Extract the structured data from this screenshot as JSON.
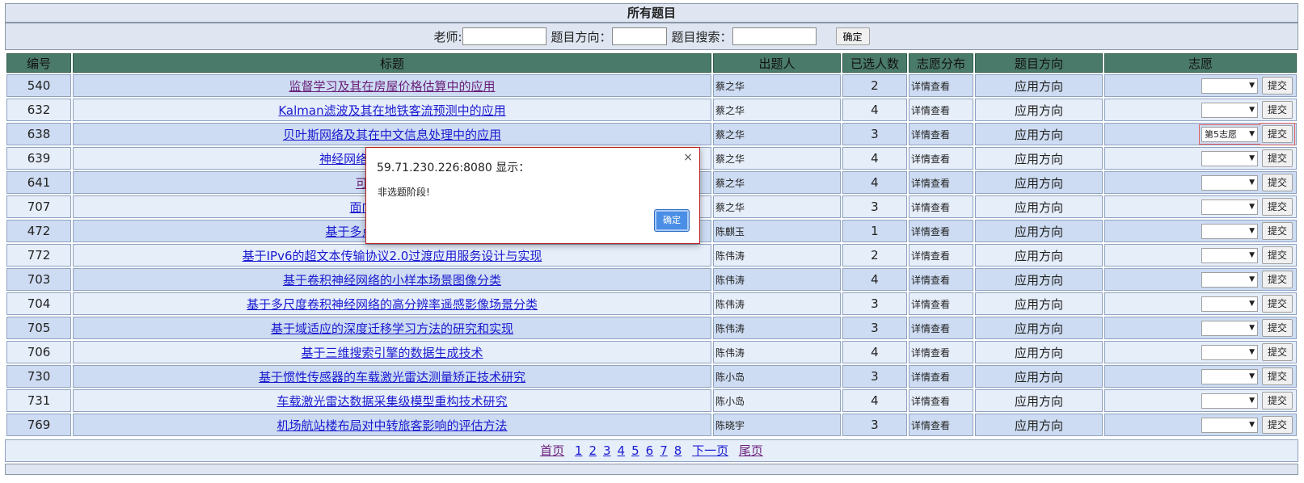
{
  "page_title": "所有题目",
  "search": {
    "teacher_label": "老师:",
    "direction_label": "题目方向：",
    "keyword_label": "题目搜索：",
    "teacher_value": "",
    "direction_value": "",
    "keyword_value": "",
    "confirm_label": "确定"
  },
  "table": {
    "headers": [
      "编号",
      "标题",
      "出题人",
      "已选人数",
      "志愿分布",
      "题目方向",
      "志愿"
    ],
    "submit_label": "提交",
    "rows": [
      {
        "id": "540",
        "title": "监督学习及其在房屋价格估算中的应用",
        "teacher": "蔡之华",
        "count": "2",
        "dist": "详情查看",
        "direction": "应用方向",
        "choice": ""
      },
      {
        "id": "632",
        "title": "Kalman滤波及其在地铁客流预测中的应用",
        "teacher": "蔡之华",
        "count": "4",
        "dist": "详情查看",
        "direction": "应用方向",
        "choice": ""
      },
      {
        "id": "638",
        "title": "贝叶斯网络及其在中文信息处理中的应用",
        "teacher": "蔡之华",
        "count": "3",
        "dist": "详情查看",
        "direction": "应用方向",
        "choice": "第5志愿"
      },
      {
        "id": "639",
        "title": "神经网络预测模型在基于W",
        "teacher": "蔡之华",
        "count": "4",
        "dist": "详情查看",
        "direction": "应用方向",
        "choice": ""
      },
      {
        "id": "641",
        "title": "可持续性指标",
        "teacher": "蔡之华",
        "count": "4",
        "dist": "详情查看",
        "direction": "应用方向",
        "choice": ""
      },
      {
        "id": "707",
        "title": "面向高光谱图像",
        "teacher": "蔡之华",
        "count": "3",
        "dist": "详情查看",
        "direction": "应用方向",
        "choice": ""
      },
      {
        "id": "472",
        "title": "基于多点统计随机模拟的",
        "teacher": "陈麒玉",
        "count": "1",
        "dist": "详情查看",
        "direction": "应用方向",
        "choice": ""
      },
      {
        "id": "772",
        "title": "基于IPv6的超文本传输协议2.0过渡应用服务设计与实现",
        "teacher": "陈伟涛",
        "count": "2",
        "dist": "详情查看",
        "direction": "应用方向",
        "choice": ""
      },
      {
        "id": "703",
        "title": "基于卷积神经网络的小样本场景图像分类",
        "teacher": "陈伟涛",
        "count": "4",
        "dist": "详情查看",
        "direction": "应用方向",
        "choice": ""
      },
      {
        "id": "704",
        "title": "基于多尺度卷积神经网络的高分辨率遥感影像场景分类",
        "teacher": "陈伟涛",
        "count": "3",
        "dist": "详情查看",
        "direction": "应用方向",
        "choice": ""
      },
      {
        "id": "705",
        "title": "基于域适应的深度迁移学习方法的研究和实现",
        "teacher": "陈伟涛",
        "count": "3",
        "dist": "详情查看",
        "direction": "应用方向",
        "choice": ""
      },
      {
        "id": "706",
        "title": "基于三维搜索引擎的数据生成技术",
        "teacher": "陈伟涛",
        "count": "4",
        "dist": "详情查看",
        "direction": "应用方向",
        "choice": ""
      },
      {
        "id": "730",
        "title": "基于惯性传感器的车载激光雷达测量矫正技术研究",
        "teacher": "陈小岛",
        "count": "3",
        "dist": "详情查看",
        "direction": "应用方向",
        "choice": ""
      },
      {
        "id": "731",
        "title": "车载激光雷达数据采集级模型重构技术研究",
        "teacher": "陈小岛",
        "count": "4",
        "dist": "详情查看",
        "direction": "应用方向",
        "choice": ""
      },
      {
        "id": "769",
        "title": "机场航站楼布局对中转旅客影响的评估方法",
        "teacher": "陈晓宇",
        "count": "3",
        "dist": "详情查看",
        "direction": "应用方向",
        "choice": ""
      }
    ]
  },
  "pager": {
    "first": "首页",
    "pages": [
      "1",
      "2",
      "3",
      "4",
      "5",
      "6",
      "7",
      "8"
    ],
    "next": "下一页",
    "last": "尾页"
  },
  "dialog": {
    "title": "59.71.230.226:8080 显示：",
    "message": "非选题阶段!",
    "ok_label": "确定",
    "close_icon": "×"
  },
  "icons": {
    "dropdown_arrow": "▼"
  },
  "colors": {
    "header_bg": "#4a7a6a",
    "row_odd": "#cddcf2",
    "row_even": "#e6eefa",
    "link": "#1a1ad0",
    "visited_link": "#6a1f7a",
    "dialog_button": "#4a8ee6"
  }
}
